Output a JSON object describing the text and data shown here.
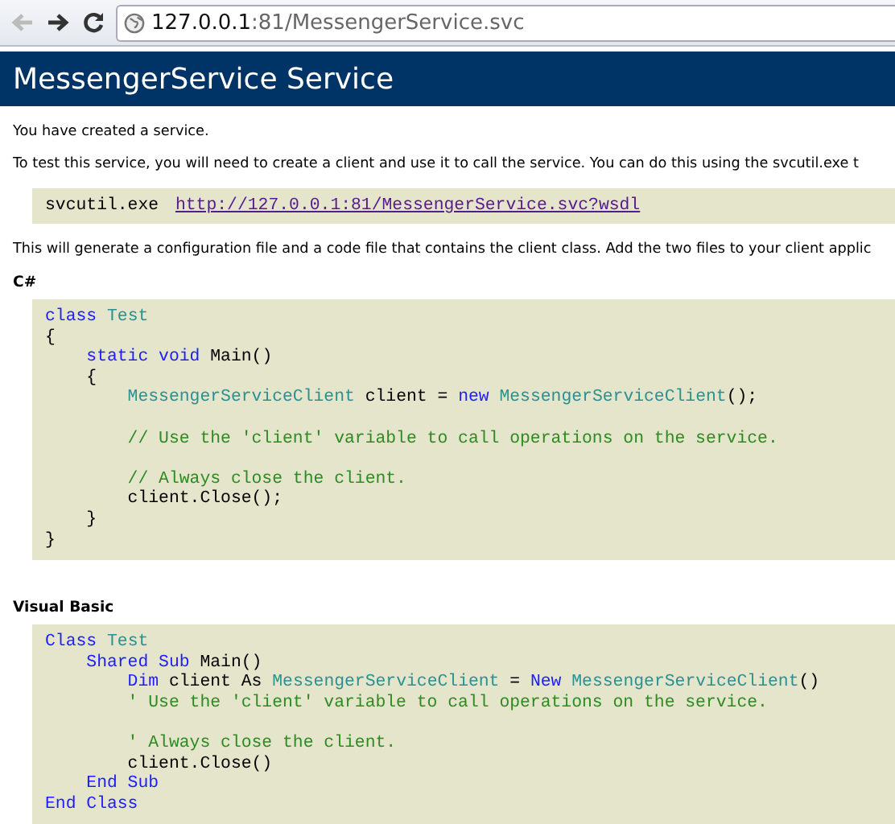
{
  "browser": {
    "back_disabled": true,
    "forward_disabled": false,
    "url_host": "127.0.0.1",
    "url_rest": ":81/MessengerService.svc"
  },
  "page_title": "MessengerService Service",
  "intro": "You have created a service.",
  "instructions": "To test this service, you will need to create a client and use it to call the service. You can do this using the svcutil.exe t",
  "command": {
    "program": "svcutil.exe",
    "link": "http://127.0.0.1:81/MessengerService.svc?wsdl"
  },
  "explanation": "This will generate a configuration file and a code file that contains the client class. Add the two files to your client applic",
  "samples": [
    {
      "heading": "C#",
      "lines": [
        {
          "tokens": [
            {
              "kind": "keyword",
              "text": "class"
            },
            {
              "kind": "type",
              "text": " Test"
            }
          ]
        },
        {
          "tokens": [
            {
              "kind": "plain",
              "text": "{"
            }
          ]
        },
        {
          "tokens": [
            {
              "kind": "keyword",
              "text": "    static void"
            },
            {
              "kind": "plain",
              "text": " Main()"
            }
          ]
        },
        {
          "tokens": [
            {
              "kind": "plain",
              "text": "    {"
            }
          ]
        },
        {
          "tokens": [
            {
              "kind": "type",
              "text": "        MessengerServiceClient"
            },
            {
              "kind": "plain",
              "text": " client = "
            },
            {
              "kind": "keyword",
              "text": "new"
            },
            {
              "kind": "type",
              "text": " MessengerServiceClient"
            },
            {
              "kind": "plain",
              "text": "();"
            }
          ]
        },
        {
          "blank_line_before": true,
          "tokens": [
            {
              "kind": "comment",
              "text": "        // Use the 'client' variable to call operations on the service."
            }
          ]
        },
        {
          "blank_line_before": true,
          "tokens": [
            {
              "kind": "comment",
              "text": "        // Always close the client."
            }
          ]
        },
        {
          "tokens": [
            {
              "kind": "plain",
              "text": "        client.Close();"
            }
          ]
        },
        {
          "tokens": [
            {
              "kind": "plain",
              "text": "    }"
            }
          ]
        },
        {
          "tokens": [
            {
              "kind": "plain",
              "text": "}"
            }
          ]
        }
      ]
    },
    {
      "heading": "Visual Basic",
      "lines": [
        {
          "tokens": [
            {
              "kind": "keyword",
              "text": "Class"
            },
            {
              "kind": "type",
              "text": " Test"
            }
          ]
        },
        {
          "tokens": [
            {
              "kind": "keyword",
              "text": "    Shared Sub"
            },
            {
              "kind": "plain",
              "text": " Main()"
            }
          ]
        },
        {
          "tokens": [
            {
              "kind": "keyword",
              "text": "        Dim"
            },
            {
              "kind": "plain",
              "text": " client As "
            },
            {
              "kind": "type",
              "text": "MessengerServiceClient"
            },
            {
              "kind": "plain",
              "text": " = "
            },
            {
              "kind": "keyword",
              "text": "New"
            },
            {
              "kind": "type",
              "text": " MessengerServiceClient"
            },
            {
              "kind": "plain",
              "text": "()"
            }
          ]
        },
        {
          "tokens": [
            {
              "kind": "comment",
              "text": "        ' Use the 'client' variable to call operations on the service."
            }
          ]
        },
        {
          "blank_line_before": true,
          "tokens": [
            {
              "kind": "comment",
              "text": "        ' Always close the client."
            }
          ]
        },
        {
          "tokens": [
            {
              "kind": "plain",
              "text": "        client.Close()"
            }
          ]
        },
        {
          "tokens": [
            {
              "kind": "keyword",
              "text": "    End Sub"
            }
          ]
        },
        {
          "tokens": [
            {
              "kind": "keyword",
              "text": "End Class"
            }
          ]
        }
      ]
    }
  ]
}
